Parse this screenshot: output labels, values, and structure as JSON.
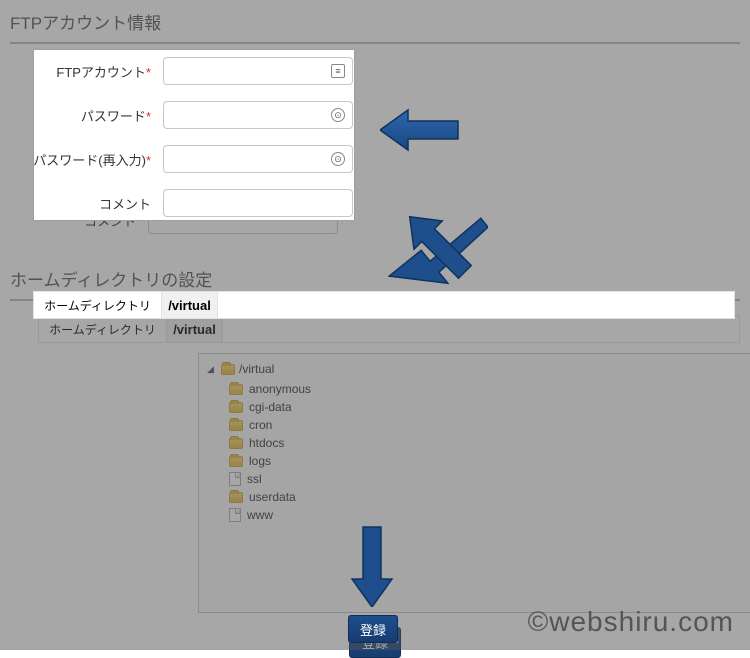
{
  "sections": {
    "account_info_title": "FTPアカウント情報",
    "homedir_title": "ホームディレクトリの設定"
  },
  "form": {
    "ftp_account_label": "FTPアカウント",
    "password_label": "パスワード",
    "password_confirm_label": "パスワード(再入力)",
    "comment_label": "コメント",
    "required_mark": "*",
    "ftp_account_value": "",
    "password_value": "",
    "password_confirm_value": "",
    "comment_value": ""
  },
  "homedir": {
    "row_label": "ホームディレクトリ",
    "prefix": "/virtual",
    "path_value": ""
  },
  "tree": {
    "root_label": "/virtual",
    "items": [
      {
        "type": "folder",
        "label": "anonymous"
      },
      {
        "type": "folder",
        "label": "cgi-data"
      },
      {
        "type": "folder",
        "label": "cron"
      },
      {
        "type": "folder",
        "label": "htdocs"
      },
      {
        "type": "folder",
        "label": "logs"
      },
      {
        "type": "file",
        "label": "ssl"
      },
      {
        "type": "folder",
        "label": "userdata"
      },
      {
        "type": "file",
        "label": "www"
      }
    ]
  },
  "submit_label": "登録",
  "watermark": "©webshiru.com"
}
